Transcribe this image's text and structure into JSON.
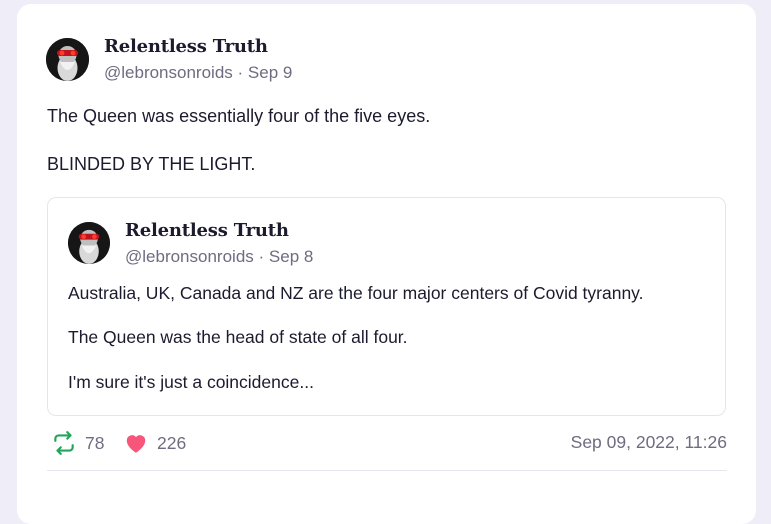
{
  "post": {
    "display_name": "Relentless Truth",
    "handle": "@lebronsonroids",
    "date": "Sep 9",
    "lines": [
      "The Queen was essentially four of the five eyes.",
      "BLINDED BY THE LIGHT."
    ]
  },
  "quoted_post": {
    "display_name": "Relentless Truth",
    "handle": "@lebronsonroids",
    "date": "Sep 8",
    "lines": [
      "Australia, UK, Canada and NZ are the four major centers of Covid tyranny.",
      "The Queen was the head of state of all four.",
      "I'm sure it's just a coincidence..."
    ]
  },
  "stats": {
    "retweet_icon": "retweet-icon",
    "retweet_count": "78",
    "retweet_color": "#22a55a",
    "like_icon": "heart-icon",
    "like_count": "226",
    "like_color": "#f7557a",
    "timestamp": "Sep 09, 2022, 11:26"
  },
  "separator": "·"
}
